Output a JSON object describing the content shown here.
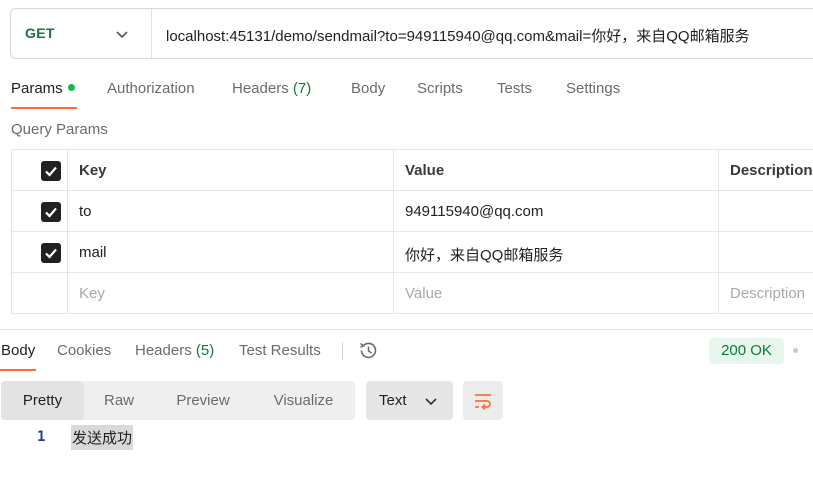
{
  "request": {
    "method": "GET",
    "url": "localhost:45131/demo/sendmail?to=949115940@qq.com&mail=你好，来自QQ邮箱服务"
  },
  "request_tabs": [
    {
      "label": "Params",
      "active": true,
      "has_dot": true
    },
    {
      "label": "Authorization"
    },
    {
      "label": "Headers",
      "count": "(7)"
    },
    {
      "label": "Body"
    },
    {
      "label": "Scripts"
    },
    {
      "label": "Tests"
    },
    {
      "label": "Settings"
    }
  ],
  "query_params": {
    "title": "Query Params",
    "columns": [
      "Key",
      "Value",
      "Description"
    ],
    "rows": [
      {
        "checked": true,
        "key": "to",
        "value": "949115940@qq.com",
        "description": ""
      },
      {
        "checked": true,
        "key": "mail",
        "value": "你好，来自QQ邮箱服务",
        "description": ""
      }
    ],
    "placeholder": {
      "key": "Key",
      "value": "Value",
      "description": "Description"
    }
  },
  "response_tabs": [
    {
      "label": "Body",
      "active": true
    },
    {
      "label": "Cookies"
    },
    {
      "label": "Headers",
      "count": "(5)"
    },
    {
      "label": "Test Results"
    }
  ],
  "status": {
    "text": "200 OK",
    "color": "#0f7b3a"
  },
  "view_modes": [
    {
      "label": "Pretty",
      "active": true
    },
    {
      "label": "Raw"
    },
    {
      "label": "Preview"
    },
    {
      "label": "Visualize"
    }
  ],
  "format": {
    "selected": "Text"
  },
  "response_body": {
    "lines": [
      {
        "number": "1",
        "text": "发送成功"
      }
    ]
  },
  "colors": {
    "accent": "#ff6c37",
    "success": "#0f7b3a"
  }
}
